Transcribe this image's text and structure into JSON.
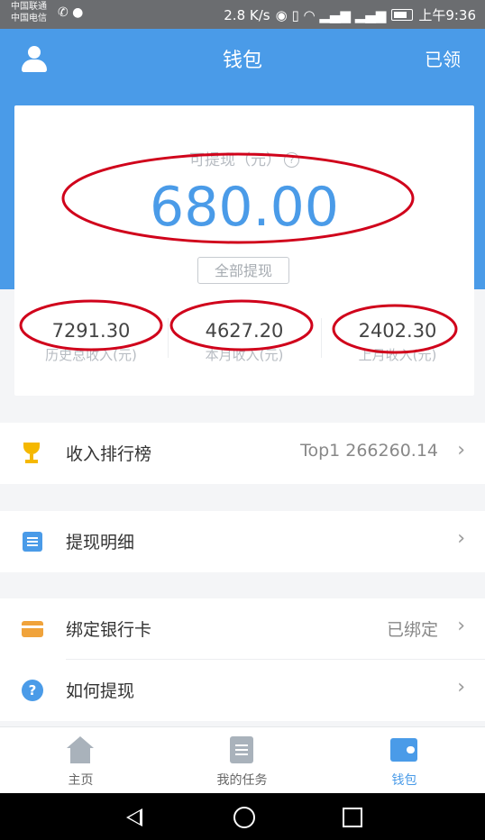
{
  "status_bar": {
    "carrier_1": "中国联通",
    "carrier_2": "中国电信",
    "speed": "2.8 K/s",
    "time": "上午9:36"
  },
  "app_bar": {
    "title": "钱包",
    "right_action": "已领"
  },
  "balance": {
    "label": "可提现（元）",
    "help_icon": "?",
    "amount": "680.00",
    "withdraw_all": "全部提现"
  },
  "stats": [
    {
      "value": "7291.30",
      "label": "历史总收入(元)"
    },
    {
      "value": "4627.20",
      "label": "本月收入(元)"
    },
    {
      "value": "2402.30",
      "label": "上月收入(元)"
    }
  ],
  "menu": {
    "ranking": {
      "label": "收入排行榜",
      "value": "Top1 266260.14",
      "icon": "trophy-icon"
    },
    "withdraw_detail": {
      "label": "提现明细",
      "icon": "list-icon"
    },
    "bind_card": {
      "label": "绑定银行卡",
      "value": "已绑定",
      "icon": "bank-card-icon"
    },
    "how_to": {
      "label": "如何提现",
      "icon": "help-icon"
    },
    "chevron": "›"
  },
  "tabs": [
    {
      "label": "主页",
      "icon": "home-icon"
    },
    {
      "label": "我的任务",
      "icon": "task-icon"
    },
    {
      "label": "钱包",
      "icon": "wallet-icon",
      "active": true
    }
  ],
  "colors": {
    "primary": "#4a9be8",
    "annotation": "#d0021b",
    "trophy": "#f5b800",
    "card": "#f0a33b"
  }
}
